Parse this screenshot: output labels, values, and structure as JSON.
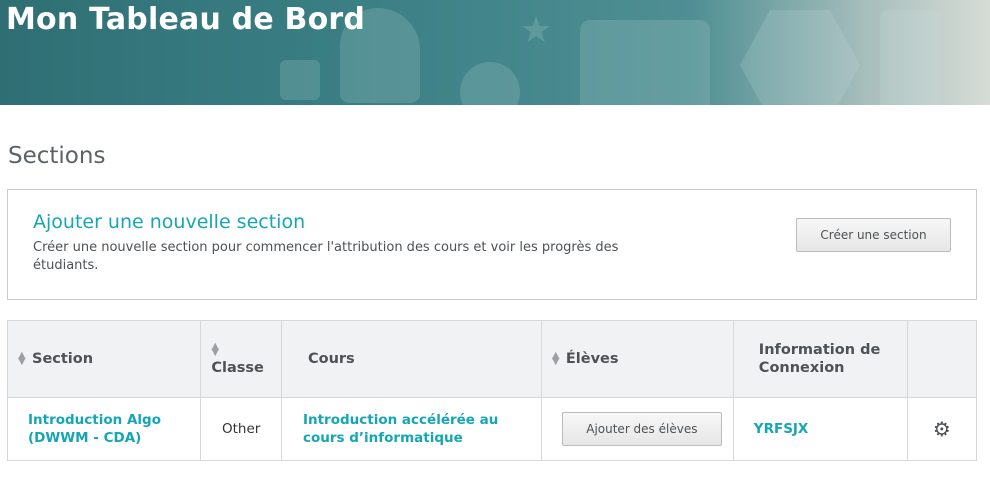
{
  "banner": {
    "title": "Mon Tableau de Bord"
  },
  "sections_heading": "Sections",
  "add_section": {
    "title": "Ajouter une nouvelle section",
    "description": "Créer une nouvelle section pour commencer l'attribution des cours et voir les progrès des étudiants.",
    "button_label": "Créer une section"
  },
  "table": {
    "headers": {
      "section": "Section",
      "classe": "Classe",
      "cours": "Cours",
      "eleves": "Élèves",
      "info": "Information de Connexion"
    },
    "rows": [
      {
        "section": "Introduction Algo (DWWM - CDA)",
        "classe": "Other",
        "cours": "Introduction accélérée au cours d’informatique",
        "eleves_button": "Ajouter des élèves",
        "code": "YRFSJX",
        "settings_icon": "gear-icon"
      }
    ]
  },
  "colors": {
    "accent": "#15a6b5",
    "text": "#4d5256",
    "banner": "#3a7f84"
  }
}
